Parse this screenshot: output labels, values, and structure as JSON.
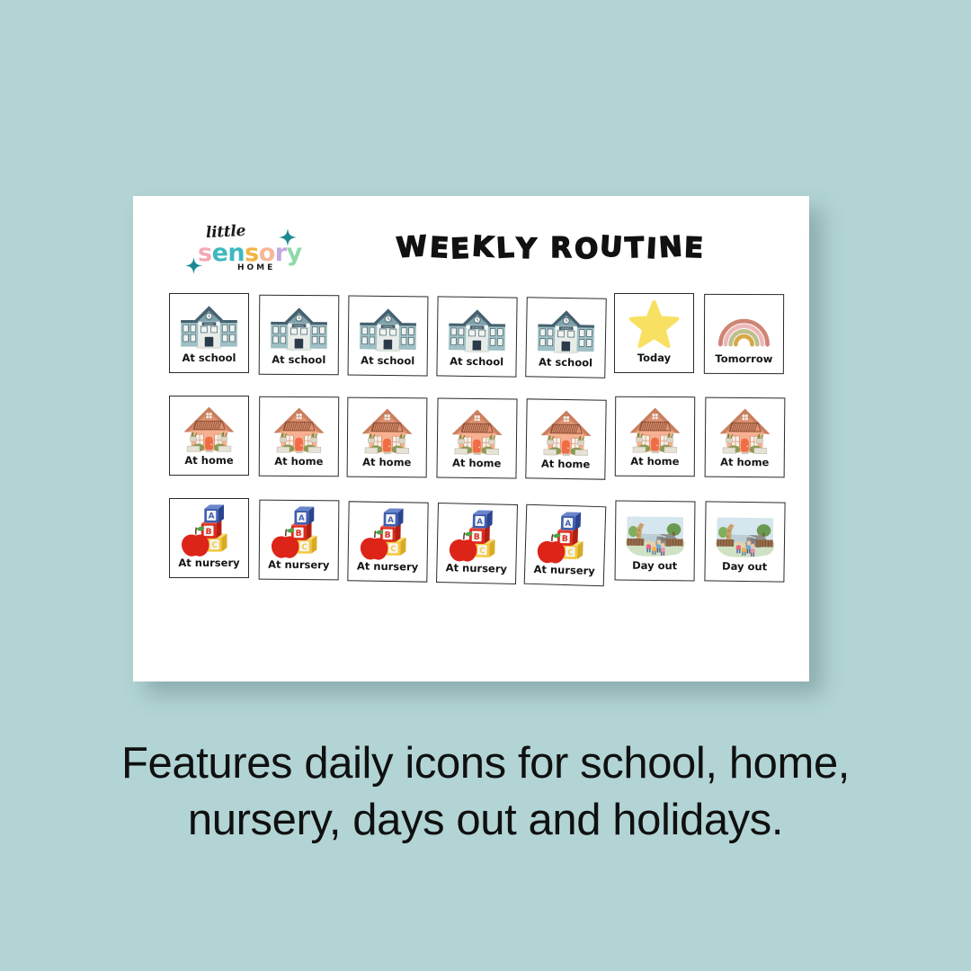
{
  "background_color": "#b2d4d4",
  "sheet": {
    "background_color": "#ffffff",
    "header": {
      "logo": {
        "line1": "little",
        "line2": "sensory",
        "line3": "HOME",
        "sensory_letters": [
          {
            "char": "s",
            "color": "#f3a9b4"
          },
          {
            "char": "e",
            "color": "#3fb8c0"
          },
          {
            "char": "n",
            "color": "#3fb8c0"
          },
          {
            "char": "s",
            "color": "#f2b441"
          },
          {
            "char": "o",
            "color": "#f6b79a"
          },
          {
            "char": "r",
            "color": "#c4a8e0"
          },
          {
            "char": "y",
            "color": "#8fd9a8"
          }
        ],
        "sparkle_color": "#1b8a92"
      },
      "title": "WEEKLY ROUTINE"
    },
    "rows": [
      {
        "name": "school-row",
        "cards": [
          {
            "label": "At school",
            "icon": "school-icon"
          },
          {
            "label": "At school",
            "icon": "school-icon"
          },
          {
            "label": "At school",
            "icon": "school-icon"
          },
          {
            "label": "At school",
            "icon": "school-icon"
          },
          {
            "label": "At school",
            "icon": "school-icon"
          },
          {
            "label": "Today",
            "icon": "star-icon"
          },
          {
            "label": "Tomorrow",
            "icon": "rainbow-icon"
          }
        ]
      },
      {
        "name": "home-row",
        "cards": [
          {
            "label": "At home",
            "icon": "house-icon"
          },
          {
            "label": "At home",
            "icon": "house-icon"
          },
          {
            "label": "At home",
            "icon": "house-icon"
          },
          {
            "label": "At home",
            "icon": "house-icon"
          },
          {
            "label": "At home",
            "icon": "house-icon"
          },
          {
            "label": "At home",
            "icon": "house-icon"
          },
          {
            "label": "At home",
            "icon": "house-icon"
          }
        ]
      },
      {
        "name": "nursery-row",
        "cards": [
          {
            "label": "At nursery",
            "icon": "abc-blocks-icon"
          },
          {
            "label": "At nursery",
            "icon": "abc-blocks-icon"
          },
          {
            "label": "At nursery",
            "icon": "abc-blocks-icon"
          },
          {
            "label": "At nursery",
            "icon": "abc-blocks-icon"
          },
          {
            "label": "At nursery",
            "icon": "abc-blocks-icon"
          },
          {
            "label": "Day out",
            "icon": "zoo-icon"
          },
          {
            "label": "Day out",
            "icon": "zoo-icon"
          }
        ]
      }
    ],
    "icon_colors": {
      "school_wall": "#9fc0c4",
      "school_roof": "#46606e",
      "school_door": "#2b3a4a",
      "house_wall": "#f7b091",
      "house_roof": "#e09271",
      "house_door": "#ef6c45",
      "star": "#f8e162",
      "rainbow_arc1": "#cf8573",
      "rainbow_arc2": "#edb8bc",
      "rainbow_arc3": "#bcc08a",
      "rainbow_arc4": "#d6a847",
      "block_a": "#3f5fb0",
      "block_b": "#dd2b1c",
      "block_c": "#f5c93e",
      "apple": "#dd2418",
      "zoo_grass": "#cfe3c4",
      "zoo_sky": "#d6e6ee"
    }
  },
  "caption": {
    "line1": "Features daily icons for school, home,",
    "line2": "nursery, days out and holidays."
  }
}
